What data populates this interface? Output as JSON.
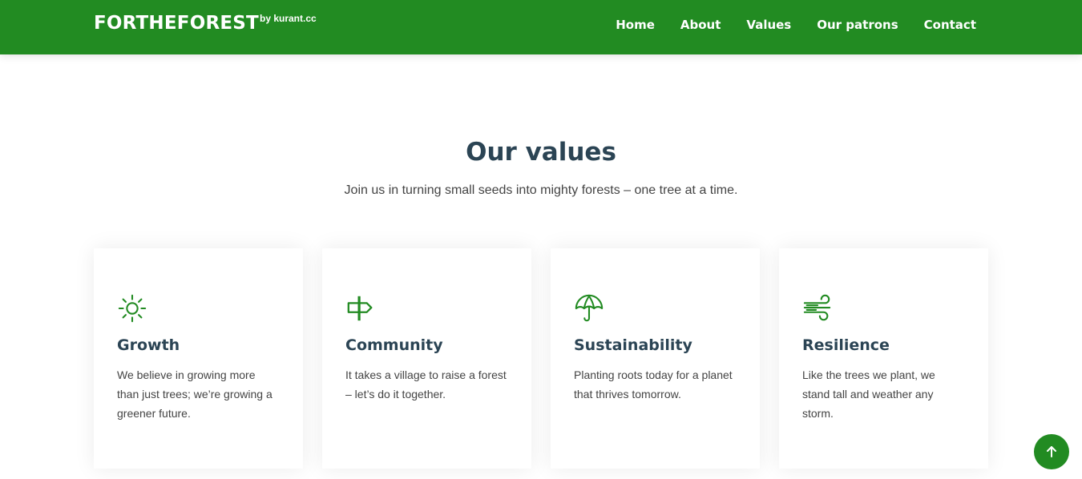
{
  "header": {
    "logo": "FORTHEFOREST",
    "logo_sub": "by kurant.cc",
    "nav": [
      {
        "label": "Home"
      },
      {
        "label": "About"
      },
      {
        "label": "Values"
      },
      {
        "label": "Our patrons"
      },
      {
        "label": "Contact"
      }
    ]
  },
  "section": {
    "title": "Our values",
    "subtitle": "Join us in turning small seeds into mighty forests – one tree at a time."
  },
  "cards": [
    {
      "icon": "sun-icon",
      "title": "Growth",
      "text": "We believe in growing more than just trees; we’re growing a greener future."
    },
    {
      "icon": "signpost-icon",
      "title": "Community",
      "text": "It takes a village to raise a forest – let’s do it together."
    },
    {
      "icon": "umbrella-icon",
      "title": "Sustainability",
      "text": "Planting roots today for a planet that thrives tomorrow."
    },
    {
      "icon": "wind-icon",
      "title": "Resilience",
      "text": "Like the trees we plant, we stand tall and weather any storm."
    }
  ],
  "colors": {
    "brand_green": "#228b22",
    "heading": "#2b4454",
    "body_text": "#444444"
  },
  "back_to_top_icon": "arrow-up-icon"
}
